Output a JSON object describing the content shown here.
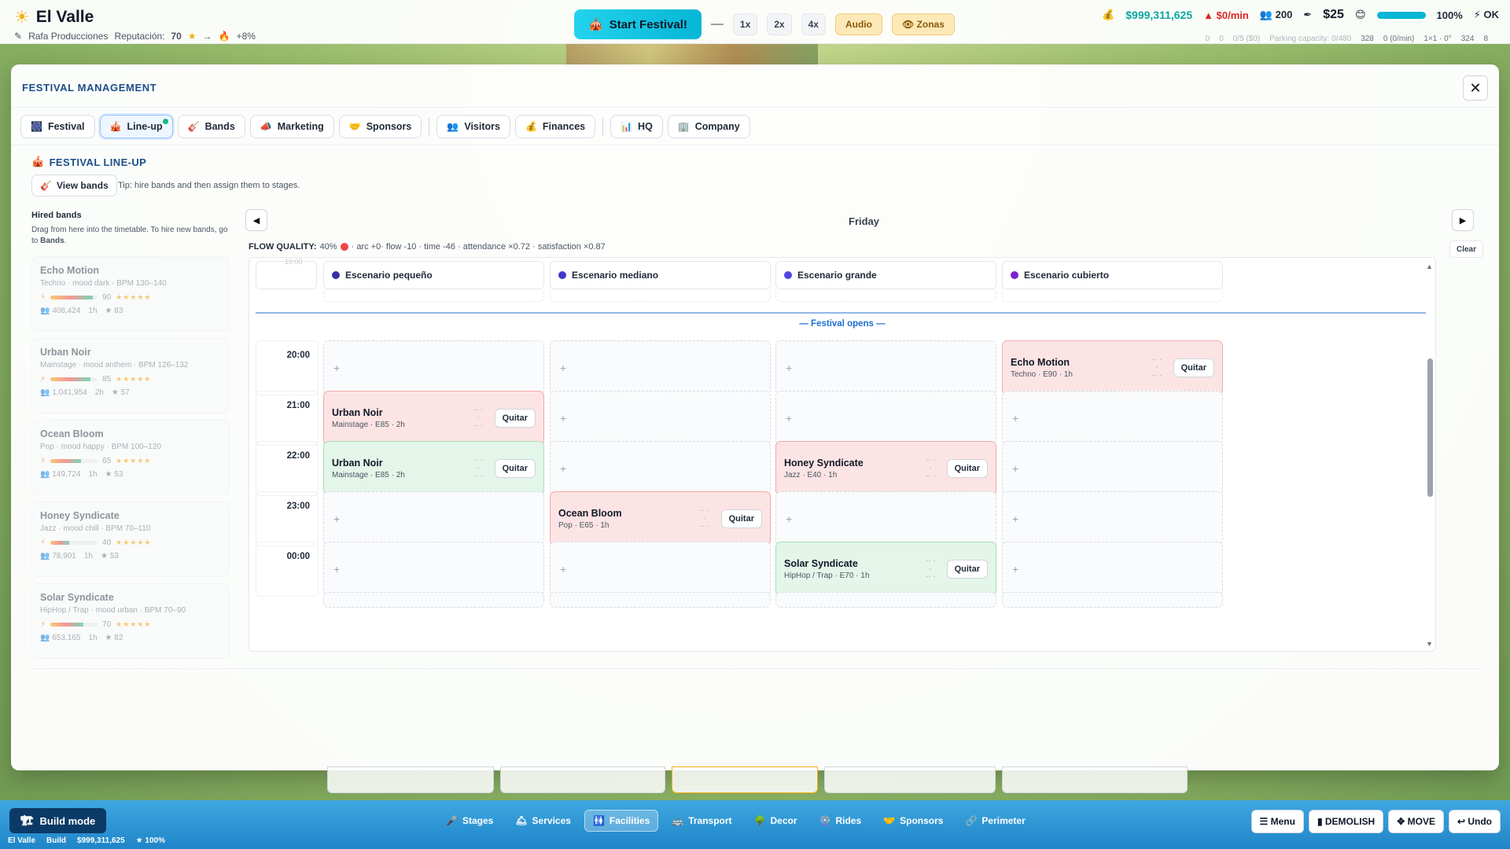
{
  "hud": {
    "park_name": "El Valle",
    "company": "Rafa Producciones",
    "reputation_label": "Reputación:",
    "reputation_value": "70",
    "reputation_arrow": "→",
    "reputation_change": "+8%",
    "start_festival": "Start Festival!",
    "speed_pause": "—",
    "speeds": [
      "1x",
      "2x",
      "4x"
    ],
    "audio": "Audio",
    "zonas": "Zonas",
    "money": "$999,311,625",
    "rate": "$0/min",
    "visitors": "200",
    "ticket_price": "$25",
    "happiness": "100%",
    "happiness_value": 100,
    "status": "OK",
    "sub_stats": [
      "0",
      "0",
      "0/5 ($0)",
      "Parking capacity: 0/480",
      "328",
      "0 (0/min)",
      "1×1 · 0°",
      "324",
      "8"
    ]
  },
  "modal": {
    "title": "FESTIVAL MANAGEMENT",
    "close": "✕",
    "tabs": [
      {
        "label": "Festival",
        "icon": "🎆"
      },
      {
        "label": "Line-up",
        "icon": "🎪"
      },
      {
        "label": "Bands",
        "icon": "🎸"
      },
      {
        "label": "Marketing",
        "icon": "📣"
      },
      {
        "label": "Sponsors",
        "icon": "🤝"
      },
      {
        "label": "Visitors",
        "icon": "👥"
      },
      {
        "label": "Finances",
        "icon": "💰"
      },
      {
        "label": "HQ",
        "icon": "📊"
      },
      {
        "label": "Company",
        "icon": "🏢"
      }
    ],
    "section_title": "FESTIVAL LINE-UP",
    "view_bands": "View bands",
    "tip": "Tip: hire bands and then assign them to stages.",
    "hired_title": "Hired bands",
    "hired_desc_1": "Drag from here into the timetable. To hire new bands, go to ",
    "hired_desc_link": "Bands",
    "hired_desc_2": ".",
    "hired_bands": [
      {
        "name": "Echo Motion",
        "meta": "Techno · mood dark · BPM 130–140",
        "score": "90",
        "level": 0.9,
        "fans": "408,424",
        "duration": "1h",
        "rating": "★ 83"
      },
      {
        "name": "Urban Noir",
        "meta": "Mainstage · mood anthem · BPM 126–132",
        "score": "85",
        "level": 0.85,
        "fans": "1,041,954",
        "duration": "2h",
        "rating": "★ 57"
      },
      {
        "name": "Ocean Bloom",
        "meta": "Pop · mood happy · BPM 100–120",
        "score": "65",
        "level": 0.65,
        "fans": "149,724",
        "duration": "1h",
        "rating": "★ 53"
      },
      {
        "name": "Honey Syndicate",
        "meta": "Jazz · mood chill · BPM 70–110",
        "score": "40",
        "level": 0.4,
        "fans": "78,901",
        "duration": "1h",
        "rating": "★ 53"
      },
      {
        "name": "Solar Syndicate",
        "meta": "HipHop / Trap · mood urban · BPM 70–90",
        "score": "70",
        "level": 0.7,
        "fans": "653,165",
        "duration": "1h",
        "rating": "★ 82"
      }
    ],
    "day": "Friday",
    "prev": "◀",
    "next": "▶",
    "clear": "Clear",
    "flow_label": "FLOW QUALITY:",
    "flow_value": "40%",
    "flow_details": "· arc +0· flow -10 · time -46 · attendance ×0.72 · satisfaction ×0.87",
    "first_time": "19:00",
    "stages": [
      {
        "name": "Escenario pequeño",
        "color": "#3730a3"
      },
      {
        "name": "Escenario mediano",
        "color": "#4338ca"
      },
      {
        "name": "Escenario grande",
        "color": "#4f46e5"
      },
      {
        "name": "Escenario cubierto",
        "color": "#7e22ce"
      }
    ],
    "festival_opens": "— Festival opens —",
    "times": [
      "20:00",
      "21:00",
      "22:00",
      "23:00",
      "00:00"
    ],
    "empty_slot": "+",
    "remove_label": "Quitar",
    "bookings": [
      {
        "band": "Echo Motion",
        "sub": "Techno · E90 · 1h",
        "row": 0,
        "stage": 3,
        "tone": "red"
      },
      {
        "band": "Urban Noir",
        "sub": "Mainstage · E85 · 2h",
        "row": 1,
        "stage": 0,
        "tone": "red"
      },
      {
        "band": "Urban Noir",
        "sub": "Mainstage · E85 · 2h",
        "row": 2,
        "stage": 0,
        "tone": "green"
      },
      {
        "band": "Honey Syndicate",
        "sub": "Jazz · E40 · 1h",
        "row": 2,
        "stage": 2,
        "tone": "red"
      },
      {
        "band": "Ocean Bloom",
        "sub": "Pop · E65 · 1h",
        "row": 3,
        "stage": 1,
        "tone": "red"
      },
      {
        "band": "Solar Syndicate",
        "sub": "HipHop / Trap · E70 · 1h",
        "row": 4,
        "stage": 2,
        "tone": "green"
      }
    ]
  },
  "bottom": {
    "build_mode": "Build mode",
    "status_park": "El Valle",
    "status_mode": "Build",
    "status_money": "$999,311,625",
    "status_rating": "★ 100%",
    "categories": [
      {
        "label": "Stages",
        "icon": "🎤"
      },
      {
        "label": "Services",
        "icon": "🛎"
      },
      {
        "label": "Facilities",
        "icon": "🚻"
      },
      {
        "label": "Transport",
        "icon": "🚌"
      },
      {
        "label": "Decor",
        "icon": "🌳"
      },
      {
        "label": "Rides",
        "icon": "🎡"
      },
      {
        "label": "Sponsors",
        "icon": "🤝"
      },
      {
        "label": "Perimeter",
        "icon": "🔗"
      }
    ],
    "active_category": "Facilities",
    "menu": "☰ Menu",
    "demolish": "▮ DEMOLISH",
    "move": "✥ MOVE",
    "undo": "↩ Undo"
  }
}
